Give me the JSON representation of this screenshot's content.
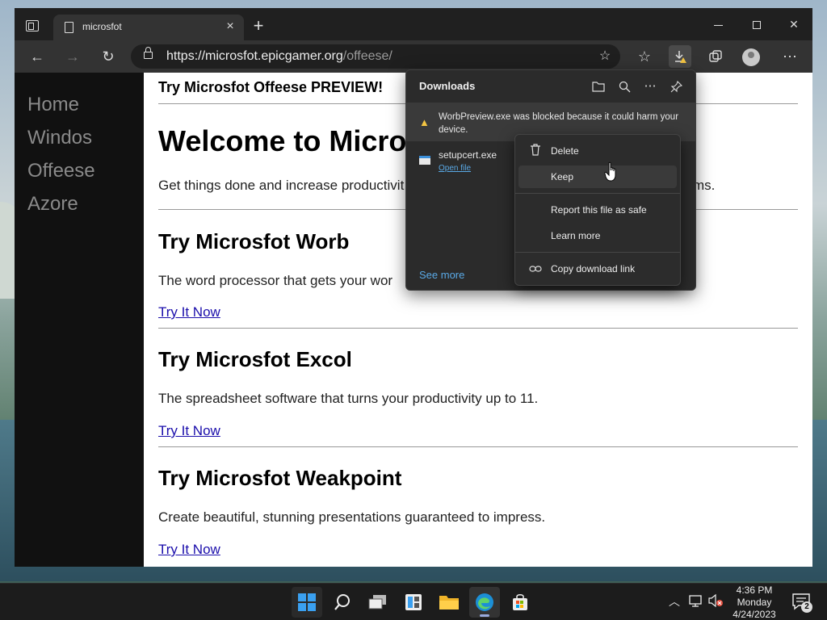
{
  "browser": {
    "tab": {
      "title": "microsfot"
    },
    "url": {
      "host": "https://microsfot.epicgamer.org",
      "path": "/offeese/"
    }
  },
  "site": {
    "nav": [
      "Home",
      "Windos",
      "Offeese",
      "Azore"
    ],
    "banner": "Try Microsfot Offeese PREVIEW!",
    "welcome": "Welcome to Micro",
    "intro_start": "Get things done and increase productivit",
    "intro_end": "ms.",
    "products": [
      {
        "title": "Try Microsfot Worb",
        "desc": "The word processor that gets your wor",
        "link": "Try It Now"
      },
      {
        "title": "Try Microsfot Excol",
        "desc": "The spreadsheet software that turns your productivity up to 11.",
        "link": "Try It Now"
      },
      {
        "title": "Try Microsfot Weakpoint",
        "desc": "Create beautiful, stunning presentations guaranteed to impress.",
        "link": "Try It Now"
      }
    ]
  },
  "downloads": {
    "title": "Downloads",
    "warning": "WorbPreview.exe was blocked because it could harm your device.",
    "file_name": "setupcert.exe",
    "open_file": "Open file",
    "see_more": "See more"
  },
  "context_menu": {
    "items": [
      "Delete",
      "Keep",
      "Report this file as safe",
      "Learn more",
      "Copy download link"
    ]
  },
  "taskbar": {
    "time": "4:36 PM",
    "day": "Monday",
    "date": "4/24/2023",
    "notification_count": "2"
  },
  "colors": {
    "accent_link": "#1a0dab",
    "downloads_link": "#5aa9e6",
    "warning": "#f4c542",
    "sidebar_bg": "#111111"
  }
}
